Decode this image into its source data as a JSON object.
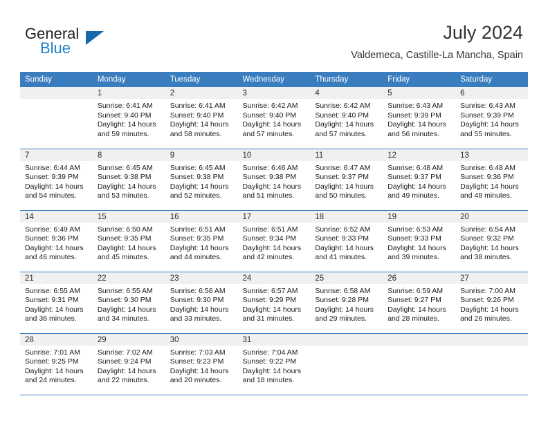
{
  "brand": {
    "name_part1": "General",
    "name_part2": "Blue",
    "accent_color": "#1f7fc4",
    "header_color": "#3a7dbf"
  },
  "header": {
    "title": "July 2024",
    "subtitle": "Valdemeca, Castille-La Mancha, Spain"
  },
  "calendar": {
    "weekday_headers": [
      "Sunday",
      "Monday",
      "Tuesday",
      "Wednesday",
      "Thursday",
      "Friday",
      "Saturday"
    ],
    "labels": {
      "sunrise": "Sunrise:",
      "sunset": "Sunset:",
      "daylight": "Daylight:"
    },
    "weeks": [
      [
        {
          "day": "",
          "sunrise": "",
          "sunset": "",
          "daylight_line1": "",
          "daylight_line2": ""
        },
        {
          "day": "1",
          "sunrise": "Sunrise: 6:41 AM",
          "sunset": "Sunset: 9:40 PM",
          "daylight_line1": "Daylight: 14 hours",
          "daylight_line2": "and 59 minutes."
        },
        {
          "day": "2",
          "sunrise": "Sunrise: 6:41 AM",
          "sunset": "Sunset: 9:40 PM",
          "daylight_line1": "Daylight: 14 hours",
          "daylight_line2": "and 58 minutes."
        },
        {
          "day": "3",
          "sunrise": "Sunrise: 6:42 AM",
          "sunset": "Sunset: 9:40 PM",
          "daylight_line1": "Daylight: 14 hours",
          "daylight_line2": "and 57 minutes."
        },
        {
          "day": "4",
          "sunrise": "Sunrise: 6:42 AM",
          "sunset": "Sunset: 9:40 PM",
          "daylight_line1": "Daylight: 14 hours",
          "daylight_line2": "and 57 minutes."
        },
        {
          "day": "5",
          "sunrise": "Sunrise: 6:43 AM",
          "sunset": "Sunset: 9:39 PM",
          "daylight_line1": "Daylight: 14 hours",
          "daylight_line2": "and 56 minutes."
        },
        {
          "day": "6",
          "sunrise": "Sunrise: 6:43 AM",
          "sunset": "Sunset: 9:39 PM",
          "daylight_line1": "Daylight: 14 hours",
          "daylight_line2": "and 55 minutes."
        }
      ],
      [
        {
          "day": "7",
          "sunrise": "Sunrise: 6:44 AM",
          "sunset": "Sunset: 9:39 PM",
          "daylight_line1": "Daylight: 14 hours",
          "daylight_line2": "and 54 minutes."
        },
        {
          "day": "8",
          "sunrise": "Sunrise: 6:45 AM",
          "sunset": "Sunset: 9:38 PM",
          "daylight_line1": "Daylight: 14 hours",
          "daylight_line2": "and 53 minutes."
        },
        {
          "day": "9",
          "sunrise": "Sunrise: 6:45 AM",
          "sunset": "Sunset: 9:38 PM",
          "daylight_line1": "Daylight: 14 hours",
          "daylight_line2": "and 52 minutes."
        },
        {
          "day": "10",
          "sunrise": "Sunrise: 6:46 AM",
          "sunset": "Sunset: 9:38 PM",
          "daylight_line1": "Daylight: 14 hours",
          "daylight_line2": "and 51 minutes."
        },
        {
          "day": "11",
          "sunrise": "Sunrise: 6:47 AM",
          "sunset": "Sunset: 9:37 PM",
          "daylight_line1": "Daylight: 14 hours",
          "daylight_line2": "and 50 minutes."
        },
        {
          "day": "12",
          "sunrise": "Sunrise: 6:48 AM",
          "sunset": "Sunset: 9:37 PM",
          "daylight_line1": "Daylight: 14 hours",
          "daylight_line2": "and 49 minutes."
        },
        {
          "day": "13",
          "sunrise": "Sunrise: 6:48 AM",
          "sunset": "Sunset: 9:36 PM",
          "daylight_line1": "Daylight: 14 hours",
          "daylight_line2": "and 48 minutes."
        }
      ],
      [
        {
          "day": "14",
          "sunrise": "Sunrise: 6:49 AM",
          "sunset": "Sunset: 9:36 PM",
          "daylight_line1": "Daylight: 14 hours",
          "daylight_line2": "and 46 minutes."
        },
        {
          "day": "15",
          "sunrise": "Sunrise: 6:50 AM",
          "sunset": "Sunset: 9:35 PM",
          "daylight_line1": "Daylight: 14 hours",
          "daylight_line2": "and 45 minutes."
        },
        {
          "day": "16",
          "sunrise": "Sunrise: 6:51 AM",
          "sunset": "Sunset: 9:35 PM",
          "daylight_line1": "Daylight: 14 hours",
          "daylight_line2": "and 44 minutes."
        },
        {
          "day": "17",
          "sunrise": "Sunrise: 6:51 AM",
          "sunset": "Sunset: 9:34 PM",
          "daylight_line1": "Daylight: 14 hours",
          "daylight_line2": "and 42 minutes."
        },
        {
          "day": "18",
          "sunrise": "Sunrise: 6:52 AM",
          "sunset": "Sunset: 9:33 PM",
          "daylight_line1": "Daylight: 14 hours",
          "daylight_line2": "and 41 minutes."
        },
        {
          "day": "19",
          "sunrise": "Sunrise: 6:53 AM",
          "sunset": "Sunset: 9:33 PM",
          "daylight_line1": "Daylight: 14 hours",
          "daylight_line2": "and 39 minutes."
        },
        {
          "day": "20",
          "sunrise": "Sunrise: 6:54 AM",
          "sunset": "Sunset: 9:32 PM",
          "daylight_line1": "Daylight: 14 hours",
          "daylight_line2": "and 38 minutes."
        }
      ],
      [
        {
          "day": "21",
          "sunrise": "Sunrise: 6:55 AM",
          "sunset": "Sunset: 9:31 PM",
          "daylight_line1": "Daylight: 14 hours",
          "daylight_line2": "and 36 minutes."
        },
        {
          "day": "22",
          "sunrise": "Sunrise: 6:55 AM",
          "sunset": "Sunset: 9:30 PM",
          "daylight_line1": "Daylight: 14 hours",
          "daylight_line2": "and 34 minutes."
        },
        {
          "day": "23",
          "sunrise": "Sunrise: 6:56 AM",
          "sunset": "Sunset: 9:30 PM",
          "daylight_line1": "Daylight: 14 hours",
          "daylight_line2": "and 33 minutes."
        },
        {
          "day": "24",
          "sunrise": "Sunrise: 6:57 AM",
          "sunset": "Sunset: 9:29 PM",
          "daylight_line1": "Daylight: 14 hours",
          "daylight_line2": "and 31 minutes."
        },
        {
          "day": "25",
          "sunrise": "Sunrise: 6:58 AM",
          "sunset": "Sunset: 9:28 PM",
          "daylight_line1": "Daylight: 14 hours",
          "daylight_line2": "and 29 minutes."
        },
        {
          "day": "26",
          "sunrise": "Sunrise: 6:59 AM",
          "sunset": "Sunset: 9:27 PM",
          "daylight_line1": "Daylight: 14 hours",
          "daylight_line2": "and 28 minutes."
        },
        {
          "day": "27",
          "sunrise": "Sunrise: 7:00 AM",
          "sunset": "Sunset: 9:26 PM",
          "daylight_line1": "Daylight: 14 hours",
          "daylight_line2": "and 26 minutes."
        }
      ],
      [
        {
          "day": "28",
          "sunrise": "Sunrise: 7:01 AM",
          "sunset": "Sunset: 9:25 PM",
          "daylight_line1": "Daylight: 14 hours",
          "daylight_line2": "and 24 minutes."
        },
        {
          "day": "29",
          "sunrise": "Sunrise: 7:02 AM",
          "sunset": "Sunset: 9:24 PM",
          "daylight_line1": "Daylight: 14 hours",
          "daylight_line2": "and 22 minutes."
        },
        {
          "day": "30",
          "sunrise": "Sunrise: 7:03 AM",
          "sunset": "Sunset: 9:23 PM",
          "daylight_line1": "Daylight: 14 hours",
          "daylight_line2": "and 20 minutes."
        },
        {
          "day": "31",
          "sunrise": "Sunrise: 7:04 AM",
          "sunset": "Sunset: 9:22 PM",
          "daylight_line1": "Daylight: 14 hours",
          "daylight_line2": "and 18 minutes."
        },
        {
          "day": "",
          "sunrise": "",
          "sunset": "",
          "daylight_line1": "",
          "daylight_line2": ""
        },
        {
          "day": "",
          "sunrise": "",
          "sunset": "",
          "daylight_line1": "",
          "daylight_line2": ""
        },
        {
          "day": "",
          "sunrise": "",
          "sunset": "",
          "daylight_line1": "",
          "daylight_line2": ""
        }
      ]
    ]
  }
}
